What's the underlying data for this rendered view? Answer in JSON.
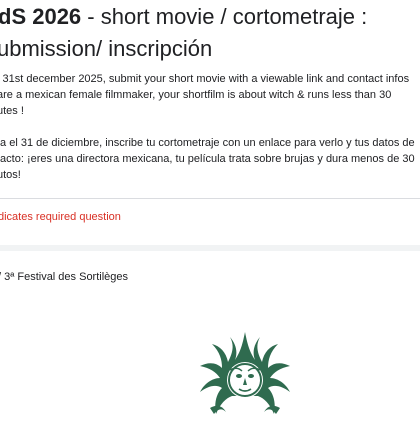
{
  "form": {
    "title_bold": "dS 2026",
    "title_rest": " - short movie / cortometraje :",
    "title_line2": "ubmission/ inscripción",
    "description_en": [
      "l 31st december 2025, submit your short movie with a viewable link and contact infos",
      "are a mexican female filmmaker, your shortfilm is about witch & runs less than 30",
      "utes !"
    ],
    "description_es": [
      "ta el 31 de diciembre, inscribe tu cortometraje con un enlace para verlo y tus datos de",
      "tacto: ¡eres una directora mexicana, tu película trata sobre brujas y dura menos de 30",
      "utos!"
    ],
    "required_note": "dicates required question"
  },
  "section": {
    "label": "/ 3ª  Festival des Sortilèges"
  },
  "colors": {
    "required_red": "#d93025",
    "logo_green": "#2f6b4f"
  },
  "icons": {
    "logo": "festival-sun-logo"
  }
}
